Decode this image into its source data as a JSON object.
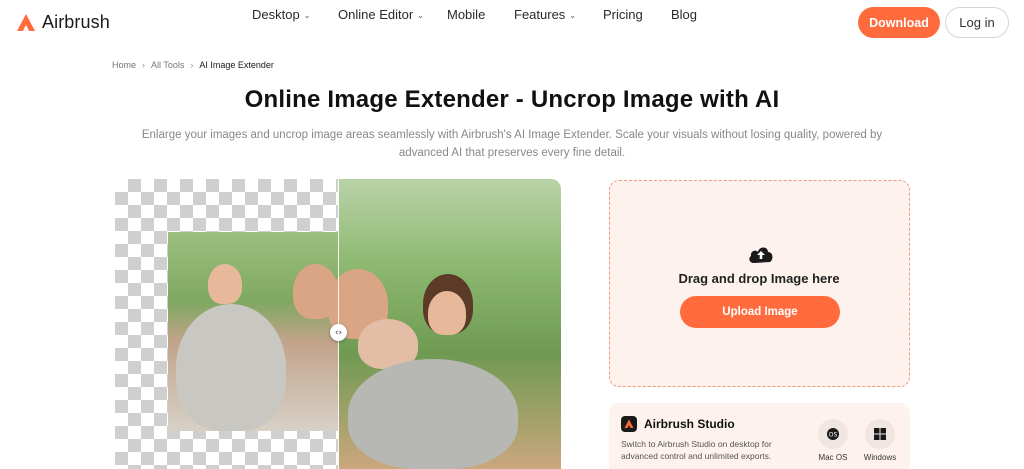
{
  "brand": {
    "name": "Airbrush",
    "accent": "#ff6b3d"
  },
  "nav": {
    "items": [
      {
        "label": "Desktop",
        "has_dropdown": true
      },
      {
        "label": "Online Editor",
        "has_dropdown": true
      },
      {
        "label": "Mobile",
        "has_dropdown": false
      },
      {
        "label": "Features",
        "has_dropdown": true
      },
      {
        "label": "Pricing",
        "has_dropdown": false
      },
      {
        "label": "Blog",
        "has_dropdown": false
      }
    ],
    "download_label": "Download",
    "login_label": "Log in"
  },
  "breadcrumb": {
    "items": [
      "Home",
      "All Tools"
    ],
    "current": "AI Image Extender"
  },
  "hero": {
    "title": "Online Image Extender - Uncrop Image with AI",
    "subtitle": "Enlarge your images and uncrop image areas seamlessly with Airbrush's AI Image Extender. Scale your visuals without losing quality, powered by advanced AI that preserves every fine detail."
  },
  "preview": {
    "compare_handle_icon": "left-right-arrows-icon"
  },
  "upload": {
    "icon": "cloud-upload-icon",
    "drop_text": "Drag and drop Image here",
    "button_label": "Upload Image"
  },
  "studio": {
    "title": "Airbrush Studio",
    "description": "Switch to Airbrush Studio on desktop for advanced control and unlimited exports.",
    "platforms": [
      {
        "label": "Mac OS",
        "icon": "apple-icon"
      },
      {
        "label": "Windows",
        "icon": "windows-icon"
      }
    ]
  }
}
